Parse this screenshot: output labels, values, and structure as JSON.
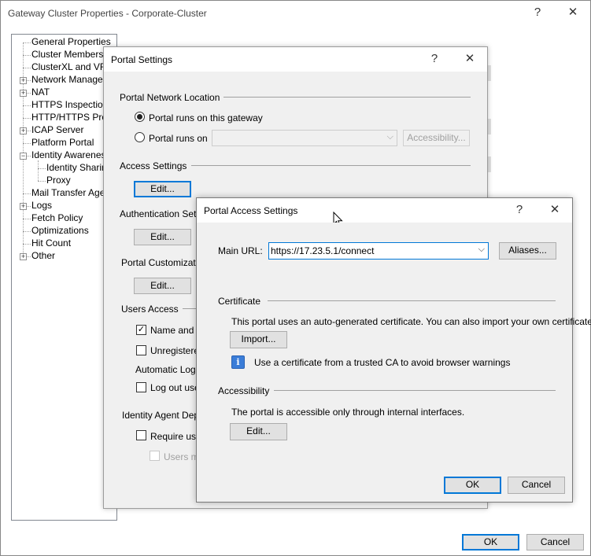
{
  "main_window": {
    "title": "Gateway Cluster Properties - Corporate-Cluster",
    "help": "?",
    "close": "✕",
    "ok_label": "OK",
    "cancel_label": "Cancel",
    "tree": [
      {
        "label": "General Properties",
        "expander": ""
      },
      {
        "label": "Cluster Members",
        "expander": ""
      },
      {
        "label": "ClusterXL and VRR",
        "expander": ""
      },
      {
        "label": "Network Manageme",
        "expander": "+"
      },
      {
        "label": "NAT",
        "expander": "+"
      },
      {
        "label": "HTTPS Inspection",
        "expander": ""
      },
      {
        "label": "HTTP/HTTPS Prox",
        "expander": ""
      },
      {
        "label": "ICAP Server",
        "expander": "+"
      },
      {
        "label": "Platform Portal",
        "expander": ""
      },
      {
        "label": "Identity Awareness",
        "expander": "−"
      },
      {
        "label": "Identity Sharing",
        "expander": ""
      },
      {
        "label": "Proxy",
        "expander": ""
      },
      {
        "label": "Mail Transfer Agent",
        "expander": ""
      },
      {
        "label": "Logs",
        "expander": "+"
      },
      {
        "label": "Fetch Policy",
        "expander": ""
      },
      {
        "label": "Optimizations",
        "expander": ""
      },
      {
        "label": "Hit Count",
        "expander": ""
      },
      {
        "label": "Other",
        "expander": "+"
      }
    ]
  },
  "portal_settings": {
    "title": "Portal Settings",
    "help": "?",
    "close": "✕",
    "network_location_label": "Portal Network Location",
    "radio_gateway": "Portal runs on this gateway",
    "radio_on": "Portal runs on",
    "accessibility_button": "Accessibility...",
    "access_settings_label": "Access Settings",
    "edit_label": "Edit...",
    "authentication_label": "Authentication Settin",
    "customization_label": "Portal Customization",
    "users_access_label": "Users Access",
    "name_and_p": "Name and p",
    "unregistered": "Unregistered",
    "automatic_logout": "Automatic Logou",
    "log_out_user": "Log out user",
    "identity_agent": "Identity Agent Deplo",
    "require_user": "Require user",
    "users_ma": "Users ma"
  },
  "portal_access": {
    "title": "Portal Access Settings",
    "help": "?",
    "close": "✕",
    "main_url_label": "Main URL:",
    "main_url_value": "https://17.23.5.1/connect",
    "aliases_button": "Aliases...",
    "certificate_label": "Certificate",
    "certificate_text": "This portal uses an auto-generated certificate. You can also import your own certificate.",
    "import_button": "Import...",
    "info_icon_glyph": "i",
    "info_text": "Use a certificate from a trusted CA to avoid browser warnings",
    "accessibility_label": "Accessibility",
    "accessibility_text": "The portal is accessible only through internal interfaces.",
    "edit_button": "Edit...",
    "ok_label": "OK",
    "cancel_label": "Cancel"
  },
  "colors": {
    "accent": "#0078d7",
    "info_icon": "#3b7dd8"
  }
}
